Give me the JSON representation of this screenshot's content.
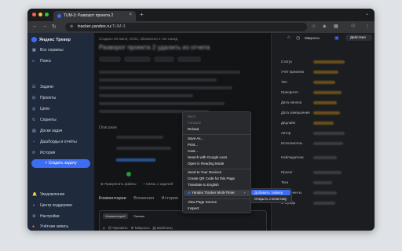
{
  "browser": {
    "tab_title": "TUM-3: Разворот проекта 2",
    "tab_close": "×",
    "new_tab": "+",
    "tab_menu": "⌄",
    "url_host": "tracker.yandex.ru",
    "url_path": "/TUM-3",
    "nav_back": "←",
    "nav_forward": "→",
    "nav_reload": "↻",
    "lock": "⊜",
    "ext1": "☆",
    "ext2": "◈",
    "ext3": "▦",
    "ext4": "⚇",
    "ext5": "⋮",
    "traffic_colors": [
      "#ff5f57",
      "#febc2e",
      "#28c840"
    ]
  },
  "sidebar": {
    "app_title": "Яндекс Трекер",
    "items": [
      {
        "icon": "▦",
        "label": "Все сервисы"
      },
      {
        "icon": "⌕",
        "label": "Поиск"
      },
      {
        "icon": "☑",
        "label": "Задачи"
      },
      {
        "icon": "⊟",
        "label": "Проекты"
      },
      {
        "icon": "◎",
        "label": "Цели"
      },
      {
        "icon": "↻",
        "label": "Спринты"
      },
      {
        "icon": "▤",
        "label": "Доски задач"
      },
      {
        "icon": "◔",
        "label": "Дашборды и отчёты"
      },
      {
        "icon": "⟳",
        "label": "История"
      }
    ],
    "create_button": "+ Создать задачу",
    "bottom_items": [
      {
        "icon": "🔔",
        "label": "Уведомления"
      },
      {
        "icon": "◑",
        "label": "Центр поддержки"
      },
      {
        "icon": "⚙",
        "label": "Настройки"
      },
      {
        "icon": "●",
        "label": "Учётная запись"
      }
    ],
    "collapse": "◂"
  },
  "issue": {
    "meta": "Создано 03 июня, 19:01, обновлено 1 час назад",
    "title": "Разворот проекта 2 удалить из отчета",
    "description_label": "Описание",
    "attach_files": "Прикрепить файлы",
    "link_issue": "Связь с задачей",
    "tabs": [
      "Комментарии",
      "Вложения",
      "История"
    ],
    "editor_tabs": [
      "Комментарий",
      "Письмо"
    ],
    "editor_toolbar": [
      "Призвать",
      "Макросы",
      "Шаблоны"
    ]
  },
  "right_panel": {
    "macros": "Макросы",
    "actions": "Действия",
    "fields": [
      "Статус",
      "Учёт времени",
      "Тип",
      "Приоритет",
      "Дата начала",
      "Дата завершения",
      "Дедлайн",
      "Автор",
      "Исполнитель",
      "Наблюдатели",
      "Проект",
      "Теги",
      "Компоненты",
      "Очередь"
    ]
  },
  "context_menu": {
    "items": [
      {
        "label": "Back",
        "disabled": true
      },
      {
        "label": "Forward",
        "disabled": true
      },
      {
        "label": "Reload",
        "disabled": false
      },
      {
        "label": "Save As...",
        "disabled": false
      },
      {
        "label": "Print...",
        "disabled": false
      },
      {
        "label": "Cast...",
        "disabled": false
      },
      {
        "label": "Search with Google Lens",
        "disabled": false
      },
      {
        "label": "Open in Reading Mode",
        "disabled": false
      },
      {
        "label": "Send to Your Devices",
        "disabled": false
      },
      {
        "label": "Create QR Code for this Page",
        "disabled": false
      },
      {
        "label": "Translate to English",
        "disabled": false
      },
      {
        "label": "Yandex Tracker Multi-Timer",
        "disabled": false,
        "has_submenu": true
      },
      {
        "label": "View Page Source",
        "disabled": false
      },
      {
        "label": "Inspect",
        "disabled": false
      }
    ],
    "submenu": [
      "Добавить таймер",
      "Открыть статистику"
    ]
  }
}
